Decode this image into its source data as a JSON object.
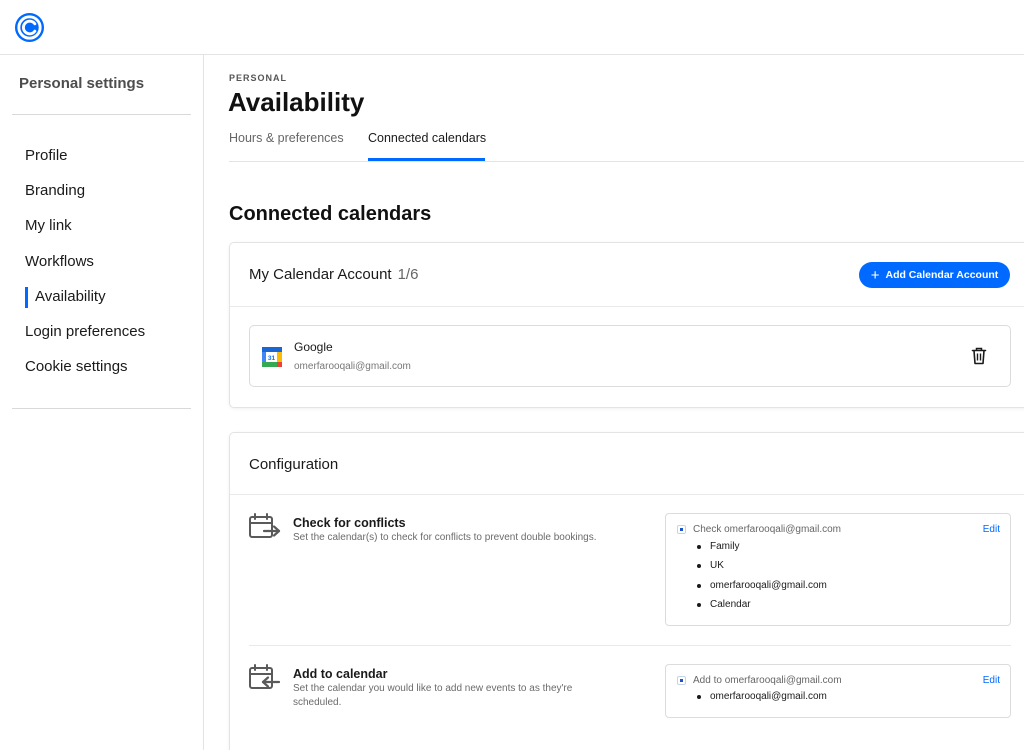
{
  "sidebar": {
    "title": "Personal settings",
    "items": [
      {
        "label": "Profile"
      },
      {
        "label": "Branding"
      },
      {
        "label": "My link"
      },
      {
        "label": "Workflows"
      },
      {
        "label": "Availability",
        "active": true
      },
      {
        "label": "Login preferences"
      },
      {
        "label": "Cookie settings"
      }
    ]
  },
  "header": {
    "eyebrow": "PERSONAL",
    "title": "Availability",
    "tabs": [
      {
        "label": "Hours & preferences"
      },
      {
        "label": "Connected calendars",
        "active": true
      }
    ]
  },
  "connected": {
    "section_title": "Connected calendars",
    "account_header": {
      "label": "My Calendar Account",
      "count": "1/6"
    },
    "add_button_label": "Add Calendar Account",
    "accounts": [
      {
        "provider": "Google",
        "email": "omerfarooqali@gmail.com",
        "icon": "google-calendar-icon"
      }
    ]
  },
  "configuration": {
    "title": "Configuration",
    "conflicts": {
      "title": "Check for conflicts",
      "description": "Set the calendar(s) to check for conflicts to prevent double bookings.",
      "box_label": "Check omerfarooqali@gmail.com",
      "edit_label": "Edit",
      "calendars": [
        "Family",
        "UK",
        "omerfarooqali@gmail.com",
        "Calendar"
      ]
    },
    "add_to": {
      "title": "Add to calendar",
      "description": "Set the calendar you would like to add new events to as they're scheduled.",
      "box_label": "Add to omerfarooqali@gmail.com",
      "edit_label": "Edit",
      "calendars": [
        "omerfarooqali@gmail.com"
      ]
    }
  },
  "colors": {
    "accent": "#0069ff",
    "text": "#1a1a1a",
    "muted": "#6b6b6b",
    "border": "#e3e3e3"
  }
}
